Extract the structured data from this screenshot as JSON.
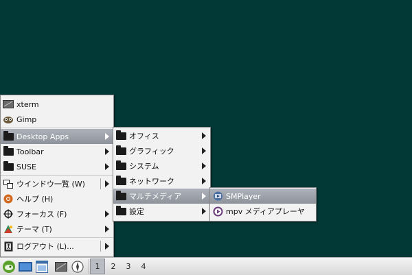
{
  "main_menu": {
    "items": [
      {
        "label": "xterm",
        "icon": "terminal-icon"
      },
      {
        "label": "Gimp",
        "icon": "gimp-icon"
      },
      {
        "label": "Desktop Apps",
        "icon": "folder-icon"
      },
      {
        "label": "Toolbar",
        "icon": "folder-icon"
      },
      {
        "label": "SUSE",
        "icon": "folder-icon"
      },
      {
        "label": "ウインドウ一覧 (W)",
        "icon": "windows-icon"
      },
      {
        "label": "ヘルプ (H)",
        "icon": "help-icon"
      },
      {
        "label": "フォーカス (F)",
        "icon": "focus-icon"
      },
      {
        "label": "テーマ (T)",
        "icon": "theme-icon"
      },
      {
        "label": "ログアウト (L)...",
        "icon": "logout-icon"
      }
    ]
  },
  "desktop_apps_menu": {
    "items": [
      {
        "label": "オフィス"
      },
      {
        "label": "グラフィック"
      },
      {
        "label": "システム"
      },
      {
        "label": "ネットワーク"
      },
      {
        "label": "マルチメディア"
      },
      {
        "label": "設定"
      }
    ]
  },
  "multimedia_menu": {
    "items": [
      {
        "label": "SMPlayer",
        "icon": "smplayer-icon"
      },
      {
        "label": "mpv メディアプレーヤ",
        "icon": "mpv-icon"
      }
    ]
  },
  "taskbar": {
    "workspaces": [
      "1",
      "2",
      "3",
      "4"
    ],
    "active_workspace": "1"
  },
  "colors": {
    "desktop_background": "#023836",
    "menu_background": "#f2f2f2",
    "selection_top": "#aeb2ba",
    "selection_bottom": "#8e939b"
  }
}
